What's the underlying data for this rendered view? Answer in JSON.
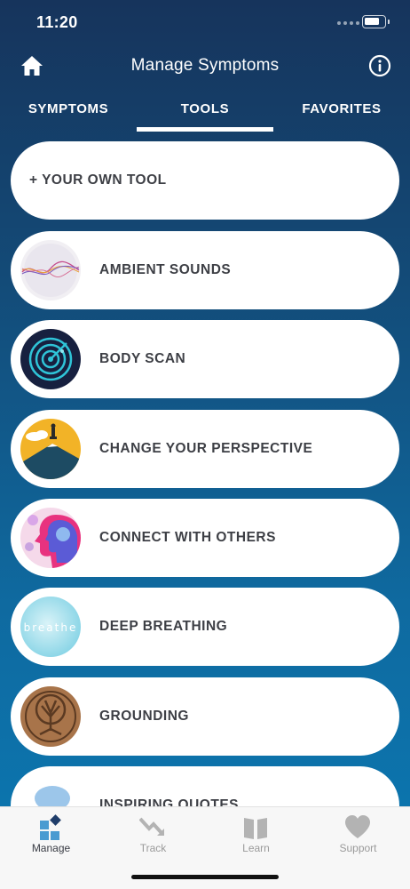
{
  "status_bar": {
    "time": "11:20"
  },
  "header": {
    "title": "Manage Symptoms",
    "home_icon": "home-icon",
    "info_icon": "info-icon"
  },
  "tabs": [
    {
      "label": "SYMPTOMS",
      "active": false
    },
    {
      "label": "TOOLS",
      "active": true
    },
    {
      "label": "FAVORITES",
      "active": false
    }
  ],
  "tools": [
    {
      "label": "+ YOUR OWN TOOL",
      "thumbnail": "none"
    },
    {
      "label": "AMBIENT SOUNDS",
      "thumbnail": "sound-wave-thumbnail"
    },
    {
      "label": "BODY SCAN",
      "thumbnail": "radar-scan-thumbnail"
    },
    {
      "label": "CHANGE YOUR PERSPECTIVE",
      "thumbnail": "mountain-summit-thumbnail"
    },
    {
      "label": "CONNECT WITH OTHERS",
      "thumbnail": "face-profile-thumbnail"
    },
    {
      "label": "DEEP BREATHING",
      "thumbnail": "breathe-thumbnail",
      "thumbnail_text": "breathe"
    },
    {
      "label": "GROUNDING",
      "thumbnail": "tree-carving-thumbnail"
    },
    {
      "label": "INSPIRING QUOTES",
      "thumbnail": "speech-bubble-thumbnail"
    }
  ],
  "bottom_nav": [
    {
      "label": "Manage",
      "icon": "manage-icon",
      "active": true
    },
    {
      "label": "Track",
      "icon": "trend-down-icon",
      "active": false
    },
    {
      "label": "Learn",
      "icon": "book-icon",
      "active": false
    },
    {
      "label": "Support",
      "icon": "heart-icon",
      "active": false
    }
  ],
  "colors": {
    "gradient_top": "#16345c",
    "gradient_bottom": "#0c74ad",
    "card_text": "#3d3f45",
    "nav_inactive": "#9a9a9a",
    "nav_active": "#3a3d45"
  }
}
